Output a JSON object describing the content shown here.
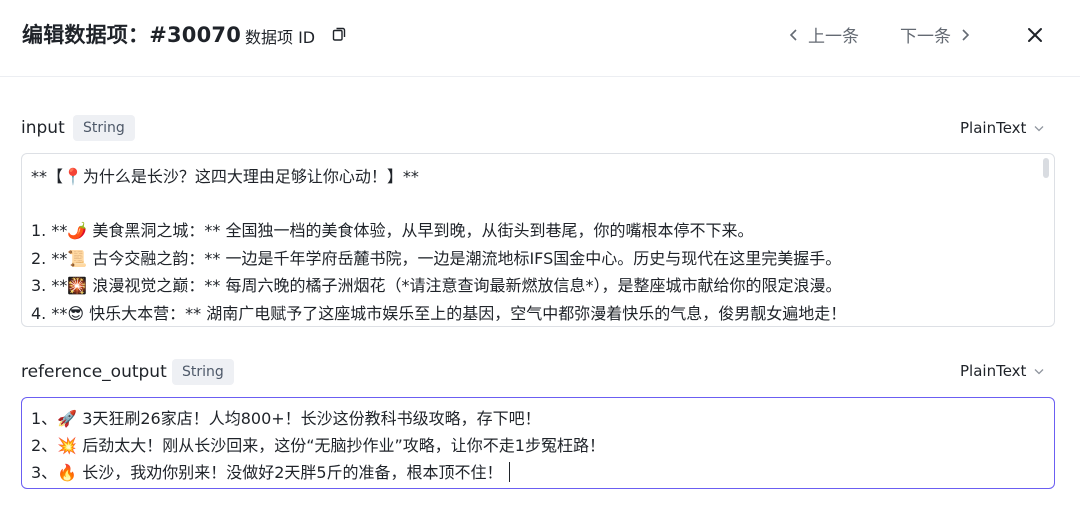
{
  "header": {
    "title": "编辑数据项：#30070",
    "id_label": "数据项 ID",
    "prev_label": "上一条",
    "next_label": "下一条"
  },
  "fields": [
    {
      "name": "input",
      "type": "String",
      "format": "PlainText",
      "lines": [
        "**【📍为什么是长沙？这四大理由足够让你心动！】**",
        "",
        "1.  **🌶️ 美食黑洞之城：** 全国独一档的美食体验，从早到晚，从街头到巷尾，你的嘴根本停不下来。",
        "2.  **📜 古今交融之韵：** 一边是千年学府岳麓书院，一边是潮流地标IFS国金中心。历史与现代在这里完美握手。",
        "3.  **🎇 浪漫视觉之巅：** 每周六晚的橘子洲烟花（*请注意查询最新燃放信息*），是整座城市献给你的限定浪漫。",
        "4.  **😎 快乐大本营：** 湖南广电赋予了这座城市娱乐至上的基因，空气中都弥漫着快乐的气息，俊男靓女遍地走！"
      ]
    },
    {
      "name": "reference_output",
      "type": "String",
      "format": "PlainText",
      "lines": [
        "1、🚀 3天狂刷26家店！人均800+！长沙这份教科书级攻略，存下吧！",
        "2、💥 后劲太大！刚从长沙回来，这份“无脑抄作业”攻略，让你不走1步冤枉路！",
        "3、🔥 长沙，我劝你别来！没做好2天胖5斤的准备，根本顶不住！"
      ]
    }
  ]
}
